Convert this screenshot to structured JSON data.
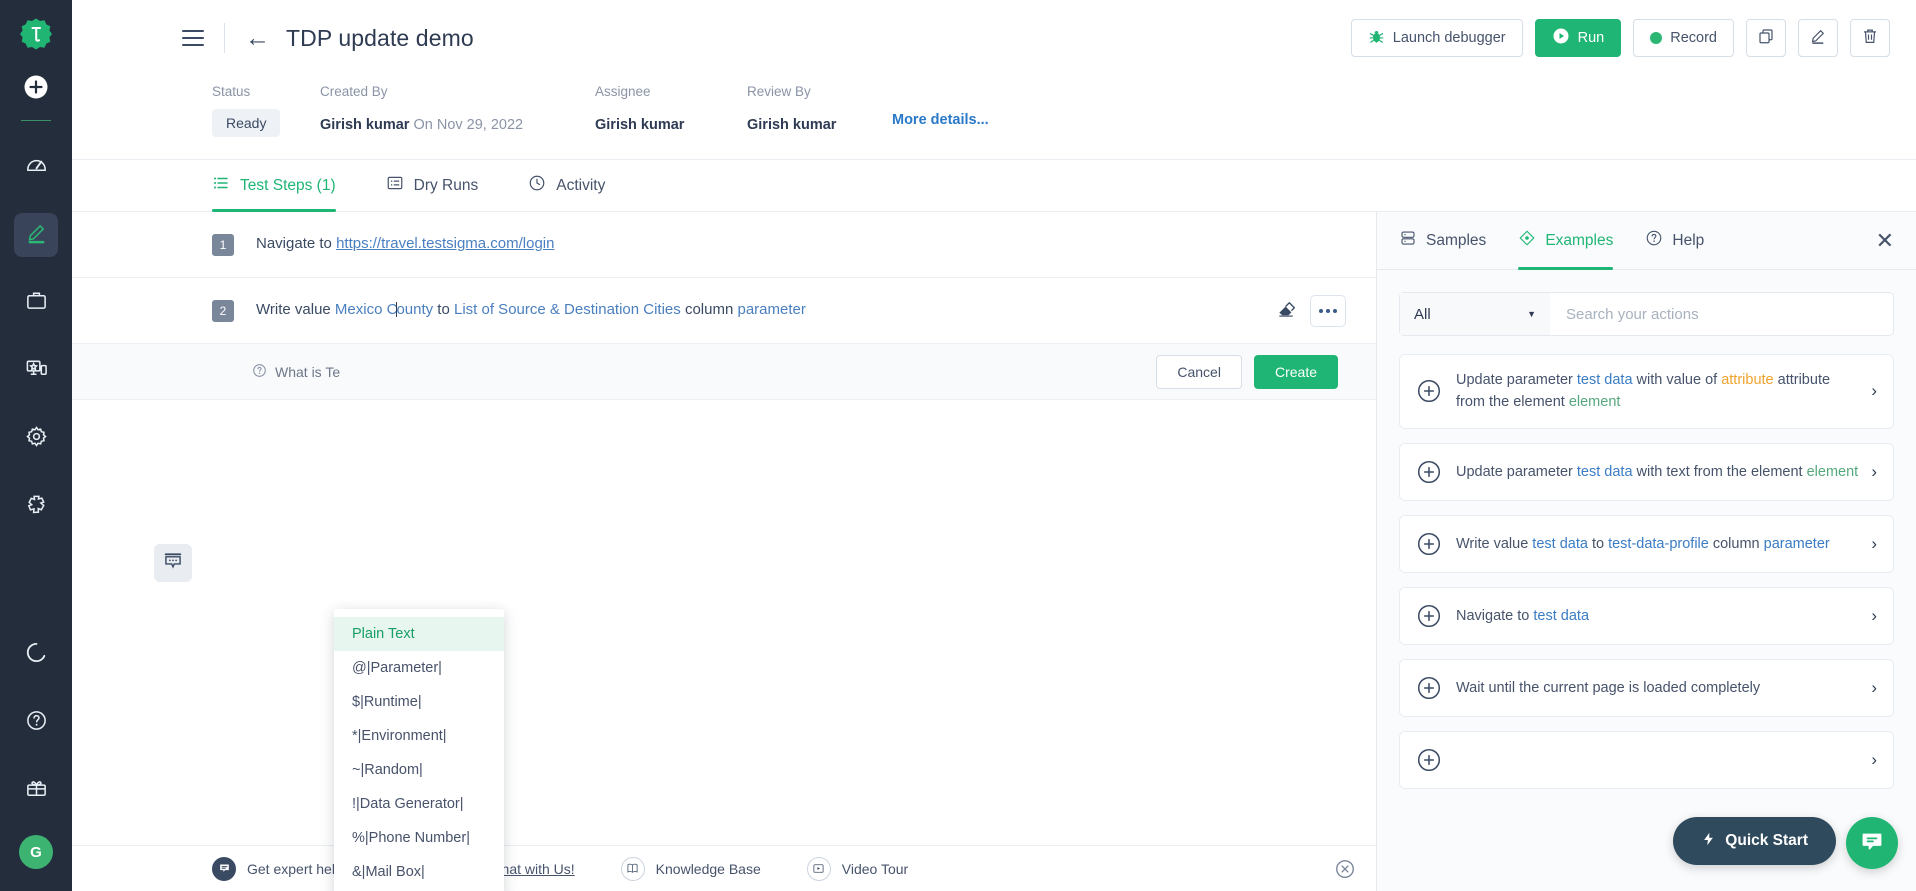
{
  "rail": {
    "logo_icon": "testsigma-logo-icon",
    "add_icon": "plus-circle-icon",
    "items": [
      {
        "icon": "speedometer-icon",
        "name": "dashboard",
        "active": false
      },
      {
        "icon": "pencil-edit-icon",
        "name": "create-tests",
        "active": true
      },
      {
        "icon": "briefcase-icon",
        "name": "test-plans",
        "active": false
      },
      {
        "icon": "devices-icon",
        "name": "test-labs",
        "active": false
      },
      {
        "icon": "gear-icon",
        "name": "settings",
        "active": false
      },
      {
        "icon": "puzzle-piece-icon",
        "name": "addons",
        "active": false
      }
    ],
    "bottom_items": [
      {
        "icon": "progress-ring-icon",
        "name": "usage"
      },
      {
        "icon": "question-circle-icon",
        "name": "help"
      },
      {
        "icon": "gift-icon",
        "name": "whats-new"
      }
    ],
    "avatar_initial": "G"
  },
  "topbar": {
    "menu_icon": "hamburger-icon",
    "back_icon": "back-arrow-icon",
    "title": "TDP update demo",
    "launch_debugger": "Launch debugger",
    "run": "Run",
    "record": "Record",
    "copy_icon": "copy-icon",
    "edit_icon": "pencil-icon",
    "delete_icon": "trash-icon"
  },
  "meta": {
    "status_label": "Status",
    "status_value": "Ready",
    "created_by_label": "Created By",
    "created_by_value": "Girish kumar",
    "created_on_value": "On Nov 29, 2022",
    "assignee_label": "Assignee",
    "assignee_value": "Girish kumar",
    "review_by_label": "Review By",
    "review_by_value": "Girish kumar",
    "more_details": "More details..."
  },
  "tabs": [
    {
      "label": "Test Steps (1)",
      "icon": "list-icon",
      "active": true
    },
    {
      "label": "Dry Runs",
      "icon": "card-list-icon",
      "active": false
    },
    {
      "label": "Activity",
      "icon": "clock-icon",
      "active": false
    }
  ],
  "steps": [
    {
      "number": "1",
      "prefix": "Navigate to",
      "link": "https://travel.testsigma.com/login"
    },
    {
      "number": "2",
      "p1": "Write value ",
      "v1": "Mexico County",
      "p2": " to ",
      "v2": "List of Source & Destination Cities",
      "p3": " column ",
      "v3": "parameter",
      "eraser_icon": "eraser-icon",
      "more_icon": "three-dots-icon"
    }
  ],
  "comment_chip_icon": "comment-icon",
  "create_row": {
    "help_icon": "question-circle-icon",
    "help_text": "What is Te",
    "cancel": "Cancel",
    "create": "Create"
  },
  "dropdown": {
    "items": [
      {
        "label": "Plain Text",
        "selected": true
      },
      {
        "label": "@|Parameter|",
        "selected": false
      },
      {
        "label": "$|Runtime|",
        "selected": false
      },
      {
        "label": "*|Environment|",
        "selected": false
      },
      {
        "label": "~|Random|",
        "selected": false
      },
      {
        "label": "!|Data Generator|",
        "selected": false
      },
      {
        "label": "%|Phone Number|",
        "selected": false
      },
      {
        "label": "&|Mail Box|",
        "selected": false
      }
    ]
  },
  "right_panel": {
    "tabs": [
      {
        "label": "Samples",
        "icon": "database-icon",
        "active": false
      },
      {
        "label": "Examples",
        "icon": "diamond-icon",
        "active": true
      },
      {
        "label": "Help",
        "icon": "question-circle-icon",
        "active": false
      }
    ],
    "close_icon": "close-icon",
    "filter_value": "All",
    "search_placeholder": "Search your actions",
    "examples": [
      {
        "parts": [
          {
            "t": "Update parameter ",
            "c": "plain"
          },
          {
            "t": "test data",
            "c": "blue"
          },
          {
            "t": " with value of ",
            "c": "plain"
          },
          {
            "t": "attribute",
            "c": "orange"
          },
          {
            "t": " attribute from the element ",
            "c": "plain"
          },
          {
            "t": "element",
            "c": "green"
          }
        ]
      },
      {
        "parts": [
          {
            "t": "Update parameter ",
            "c": "plain"
          },
          {
            "t": "test data",
            "c": "blue"
          },
          {
            "t": " with text from the element ",
            "c": "plain"
          },
          {
            "t": "element",
            "c": "green"
          }
        ]
      },
      {
        "parts": [
          {
            "t": "Write value ",
            "c": "plain"
          },
          {
            "t": "test data",
            "c": "blue"
          },
          {
            "t": " to ",
            "c": "plain"
          },
          {
            "t": "test-data-profile",
            "c": "blue"
          },
          {
            "t": " column ",
            "c": "plain"
          },
          {
            "t": "parameter",
            "c": "blue"
          }
        ]
      },
      {
        "parts": [
          {
            "t": "Navigate to ",
            "c": "plain"
          },
          {
            "t": "test data",
            "c": "blue"
          }
        ]
      },
      {
        "parts": [
          {
            "t": "Wait until the current page is loaded completely",
            "c": "plain"
          }
        ]
      },
      {
        "parts": [
          {
            "t": "",
            "c": "plain"
          }
        ]
      }
    ],
    "quick_start": "Quick Start",
    "quick_start_icon": "lightning-icon",
    "chat_icon": "chat-bubble-icon"
  },
  "footer": {
    "chat_icon": "chat-icon",
    "expert_text": "Get expert help for Test Case creation,",
    "chat_link": "Chat with Us!",
    "kb_icon": "book-icon",
    "kb_label": "Knowledge Base",
    "video_icon": "play-icon",
    "video_label": "Video Tour",
    "close_icon": "close-circle-icon"
  },
  "colors": {
    "accent_green": "#1fb574",
    "rail_dark": "#242d3c",
    "link_blue": "#3a7cc4",
    "orange": "#f0a32c"
  }
}
